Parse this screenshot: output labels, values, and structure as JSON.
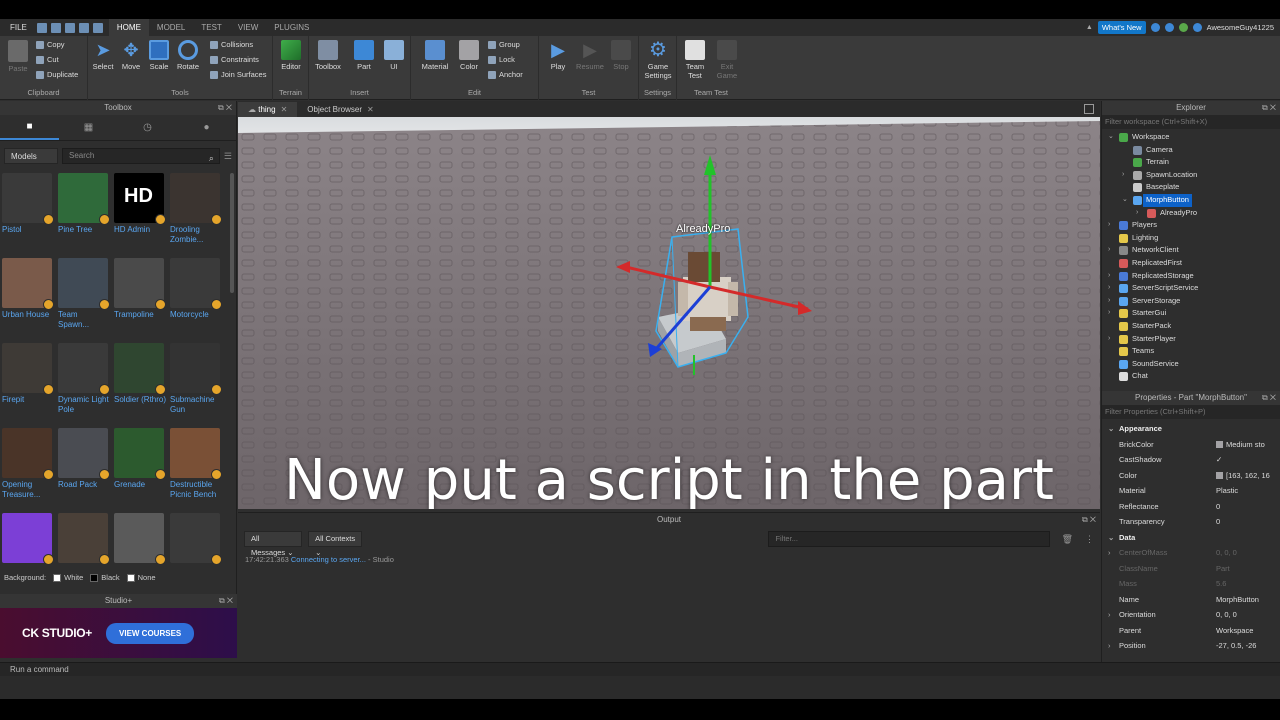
{
  "menubar": {
    "file": "FILE",
    "tabs": [
      "HOME",
      "MODEL",
      "TEST",
      "VIEW",
      "PLUGINS"
    ],
    "whats_new": "What's New",
    "username": "AwesomeGuy41225"
  },
  "ribbon": {
    "clipboard": {
      "paste": "Paste",
      "copy": "Copy",
      "cut": "Cut",
      "duplicate": "Duplicate",
      "label": "Clipboard"
    },
    "tools": {
      "select": "Select",
      "move": "Move",
      "scale": "Scale",
      "rotate": "Rotate",
      "collisions": "Collisions",
      "constraints": "Constraints",
      "join_surfaces": "Join Surfaces",
      "label": "Tools"
    },
    "terrain": {
      "editor": "Editor",
      "label": "Terrain"
    },
    "insert": {
      "toolbox": "Toolbox",
      "part": "Part",
      "ui": "UI",
      "label": "Insert"
    },
    "edit": {
      "material": "Material",
      "color": "Color",
      "group": "Group",
      "lock": "Lock",
      "anchor": "Anchor",
      "label": "Edit"
    },
    "test": {
      "play": "Play",
      "resume": "Resume",
      "stop": "Stop",
      "label": "Test"
    },
    "settings": {
      "game_settings_1": "Game",
      "game_settings_2": "Settings",
      "label": "Settings"
    },
    "team_test": {
      "team_test_1": "Team",
      "team_test_2": "Test",
      "exit_game_1": "Exit",
      "exit_game_2": "Game",
      "label": "Team Test"
    }
  },
  "toolbox": {
    "title": "Toolbox",
    "category": "Models",
    "search_placeholder": "Search",
    "items": [
      {
        "name": "Pistol",
        "color": "#3a3a3a"
      },
      {
        "name": "Pine Tree",
        "color": "#2f6a3a"
      },
      {
        "name": "HD Admin",
        "color": "#000000"
      },
      {
        "name": "Drooling Zombie...",
        "color": "#3b3430"
      },
      {
        "name": "Urban House",
        "color": "#7a5a4a"
      },
      {
        "name": "Team Spawn...",
        "color": "#404a55"
      },
      {
        "name": "Trampoline",
        "color": "#4a4a4a"
      },
      {
        "name": "Motorcycle",
        "color": "#3a3a3a"
      },
      {
        "name": "Firepit",
        "color": "#3e3a36"
      },
      {
        "name": "Dynamic Light Pole",
        "color": "#3a3a3a"
      },
      {
        "name": "Soldier (Rthro)",
        "color": "#2f4630"
      },
      {
        "name": "Submachine Gun",
        "color": "#333333"
      },
      {
        "name": "Opening Treasure...",
        "color": "#4a3428"
      },
      {
        "name": "Road Pack",
        "color": "#4a4c52"
      },
      {
        "name": "Grenade",
        "color": "#2c5a2e"
      },
      {
        "name": "Destructible Picnic Bench",
        "color": "#7a5036"
      },
      {
        "name": "",
        "color": "#7c3fd6"
      },
      {
        "name": "",
        "color": "#4a4038"
      },
      {
        "name": "",
        "color": "#5a5a5a"
      },
      {
        "name": "",
        "color": "#3a3a3a"
      }
    ],
    "background_label": "Background:",
    "bg_white": "White",
    "bg_black": "Black",
    "bg_none": "None"
  },
  "studioplus": {
    "title": "Studio+",
    "logo": "CK STUDIO+",
    "button": "VIEW COURSES"
  },
  "doc_tabs": [
    "thing",
    "Object Browser"
  ],
  "viewport": {
    "character_name": "AlreadyPro",
    "subtitle": "Now put a script in the part"
  },
  "output": {
    "title": "Output",
    "messages_filter": "All Messages",
    "contexts_filter": "All Contexts",
    "filter_placeholder": "Filter...",
    "lines": [
      {
        "time": "17:42:21.363",
        "text": "Connecting to server...",
        "source": " - Studio"
      }
    ]
  },
  "explorer": {
    "title": "Explorer",
    "filter_placeholder": "Filter workspace (Ctrl+Shift+X)",
    "tree": [
      {
        "label": "Workspace",
        "depth": 0,
        "arrow": "v",
        "icon": "#4aa84a"
      },
      {
        "label": "Camera",
        "depth": 1,
        "arrow": "",
        "icon": "#7a8aa0"
      },
      {
        "label": "Terrain",
        "depth": 1,
        "arrow": "",
        "icon": "#4aa84a"
      },
      {
        "label": "SpawnLocation",
        "depth": 1,
        "arrow": ">",
        "icon": "#aaaaaa"
      },
      {
        "label": "Baseplate",
        "depth": 1,
        "arrow": "",
        "icon": "#cccccc"
      },
      {
        "label": "MorphButton",
        "depth": 1,
        "arrow": "v",
        "icon": "#5aa6f0",
        "selected": true
      },
      {
        "label": "AlreadyPro",
        "depth": 2,
        "arrow": ">",
        "icon": "#d65a5a"
      },
      {
        "label": "Players",
        "depth": 0,
        "arrow": ">",
        "icon": "#4a7ad6"
      },
      {
        "label": "Lighting",
        "depth": 0,
        "arrow": "",
        "icon": "#e5c84a"
      },
      {
        "label": "NetworkClient",
        "depth": 0,
        "arrow": ">",
        "icon": "#888888"
      },
      {
        "label": "ReplicatedFirst",
        "depth": 0,
        "arrow": "",
        "icon": "#d65a5a"
      },
      {
        "label": "ReplicatedStorage",
        "depth": 0,
        "arrow": ">",
        "icon": "#4a7ad6"
      },
      {
        "label": "ServerScriptService",
        "depth": 0,
        "arrow": ">",
        "icon": "#5aa6f0"
      },
      {
        "label": "ServerStorage",
        "depth": 0,
        "arrow": ">",
        "icon": "#5aa6f0"
      },
      {
        "label": "StarterGui",
        "depth": 0,
        "arrow": ">",
        "icon": "#e5c84a"
      },
      {
        "label": "StarterPack",
        "depth": 0,
        "arrow": "",
        "icon": "#e5c84a"
      },
      {
        "label": "StarterPlayer",
        "depth": 0,
        "arrow": ">",
        "icon": "#e5c84a"
      },
      {
        "label": "Teams",
        "depth": 0,
        "arrow": "",
        "icon": "#e5c84a"
      },
      {
        "label": "SoundService",
        "depth": 0,
        "arrow": "",
        "icon": "#5aa6f0"
      },
      {
        "label": "Chat",
        "depth": 0,
        "arrow": "",
        "icon": "#dddddd"
      }
    ]
  },
  "properties": {
    "title": "Properties - Part \"MorphButton\"",
    "filter_placeholder": "Filter Properties (Ctrl+Shift+P)",
    "rows": [
      {
        "name": "Appearance",
        "value": "",
        "category": true,
        "arrow": "v"
      },
      {
        "name": "BrickColor",
        "value": "Medium sto",
        "swatch": "#a3a2a5"
      },
      {
        "name": "CastShadow",
        "value": "✓"
      },
      {
        "name": "Color",
        "value": "[163, 162, 16",
        "swatch": "#a3a2a5"
      },
      {
        "name": "Material",
        "value": "Plastic"
      },
      {
        "name": "Reflectance",
        "value": "0"
      },
      {
        "name": "Transparency",
        "value": "0"
      },
      {
        "name": "Data",
        "value": "",
        "category": true,
        "arrow": "v"
      },
      {
        "name": "CenterOfMass",
        "value": "0, 0, 0",
        "dim": true,
        "arrow": ">"
      },
      {
        "name": "ClassName",
        "value": "Part",
        "dim": true
      },
      {
        "name": "Mass",
        "value": "5.6",
        "dim": true
      },
      {
        "name": "Name",
        "value": "MorphButton"
      },
      {
        "name": "Orientation",
        "value": "0, 0, 0",
        "arrow": ">"
      },
      {
        "name": "Parent",
        "value": "Workspace"
      },
      {
        "name": "Position",
        "value": "-27, 0.5, -26",
        "arrow": ">"
      }
    ]
  },
  "command_bar": {
    "placeholder": "Run a command"
  }
}
